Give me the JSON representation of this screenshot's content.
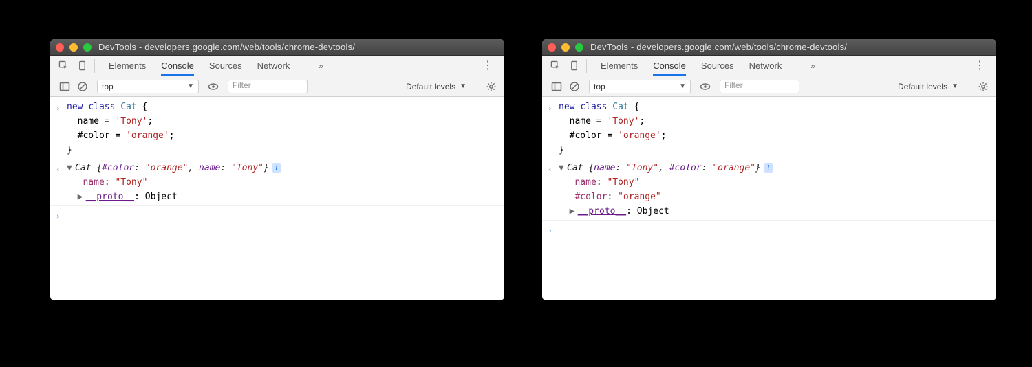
{
  "title": "DevTools - developers.google.com/web/tools/chrome-devtools/",
  "tabs": {
    "elements": "Elements",
    "console": "Console",
    "sources": "Sources",
    "network": "Network"
  },
  "toolbar": {
    "context": "top",
    "filter_placeholder": "Filter",
    "levels": "Default levels"
  },
  "code": {
    "kw_new": "new",
    "kw_class": "class",
    "classname": "Cat",
    "brace_open": " {",
    "line2_pre": "  name = ",
    "str_tony": "'Tony'",
    "line2_post": ";",
    "line3_pre": "  #color = ",
    "str_orange": "'orange'",
    "line3_post": ";",
    "brace_close": "}"
  },
  "output_left": {
    "summary": {
      "cls": "Cat ",
      "open": "{",
      "p1": "#color",
      "v1": "\"orange\"",
      "sep": ", ",
      "p2": "name",
      "v2": "\"Tony\"",
      "close": "}"
    },
    "props": {
      "name_key": "name",
      "name_val": "\"Tony\"",
      "proto_key": "__proto__",
      "proto_val": "Object"
    }
  },
  "output_right": {
    "summary": {
      "cls": "Cat ",
      "open": "{",
      "p1": "name",
      "v1": "\"Tony\"",
      "sep": ", ",
      "p2": "#color",
      "v2": "\"orange\"",
      "close": "}"
    },
    "props": {
      "name_key": "name",
      "name_val": "\"Tony\"",
      "color_key": "#color",
      "color_val": "\"orange\"",
      "proto_key": "__proto__",
      "proto_val": "Object"
    }
  }
}
